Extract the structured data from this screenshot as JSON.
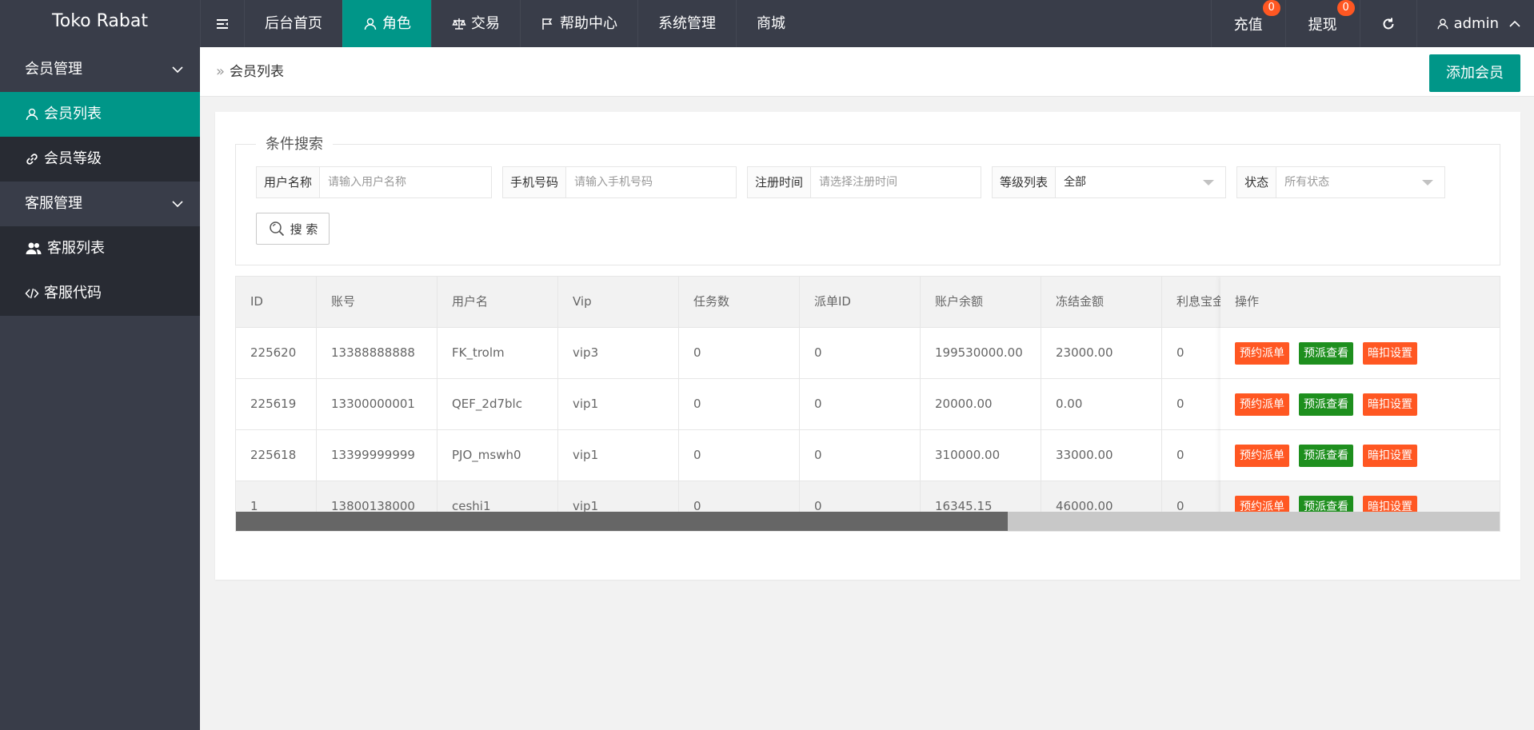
{
  "header": {
    "logo": "Toko Rabat",
    "nav": [
      {
        "label": "后台首页"
      },
      {
        "label": "角色"
      },
      {
        "label": "交易"
      },
      {
        "label": "帮助中心"
      },
      {
        "label": "系统管理"
      },
      {
        "label": "商城"
      }
    ],
    "right": {
      "recharge": "充值",
      "recharge_badge": "0",
      "withdraw": "提现",
      "withdraw_badge": "0",
      "user": "admin"
    }
  },
  "sidebar": {
    "groups": [
      {
        "label": "会员管理",
        "items": [
          {
            "label": "会员列表"
          },
          {
            "label": "会员等级"
          }
        ]
      },
      {
        "label": "客服管理",
        "items": [
          {
            "label": "客服列表"
          },
          {
            "label": "客服代码"
          }
        ]
      }
    ]
  },
  "breadcrumb": "会员列表",
  "add_button": "添加会员",
  "search": {
    "legend": "条件搜索",
    "fields": [
      {
        "label": "用户名称",
        "placeholder": "请输入用户名称"
      },
      {
        "label": "手机号码",
        "placeholder": "请输入手机号码"
      },
      {
        "label": "注册时间",
        "placeholder": "请选择注册时间"
      },
      {
        "label": "等级列表",
        "value": "全部"
      },
      {
        "label": "状态",
        "placeholder": "所有状态"
      }
    ],
    "button": "搜 索"
  },
  "table": {
    "columns": [
      "ID",
      "账号",
      "用户名",
      "Vip",
      "任务数",
      "派单ID",
      "账户余额",
      "冻结金额",
      "利息宝金额"
    ],
    "ops_header": "操作",
    "rows": [
      [
        "225620",
        "13388888888",
        "FK_trolm",
        "vip3",
        "0",
        "0",
        "199530000.00",
        "23000.00",
        "0"
      ],
      [
        "225619",
        "13300000001",
        "QEF_2d7blc",
        "vip1",
        "0",
        "0",
        "20000.00",
        "0.00",
        "0"
      ],
      [
        "225618",
        "13399999999",
        "PJO_mswh0",
        "vip1",
        "0",
        "0",
        "310000.00",
        "33000.00",
        "0"
      ],
      [
        "1",
        "13800138000",
        "ceshi1",
        "vip1",
        "0",
        "0",
        "16345.15",
        "46000.00",
        "0"
      ]
    ],
    "actions": [
      "预约派单",
      "预派查看",
      "暗扣设置"
    ],
    "scroll_fraction": 0.61
  }
}
